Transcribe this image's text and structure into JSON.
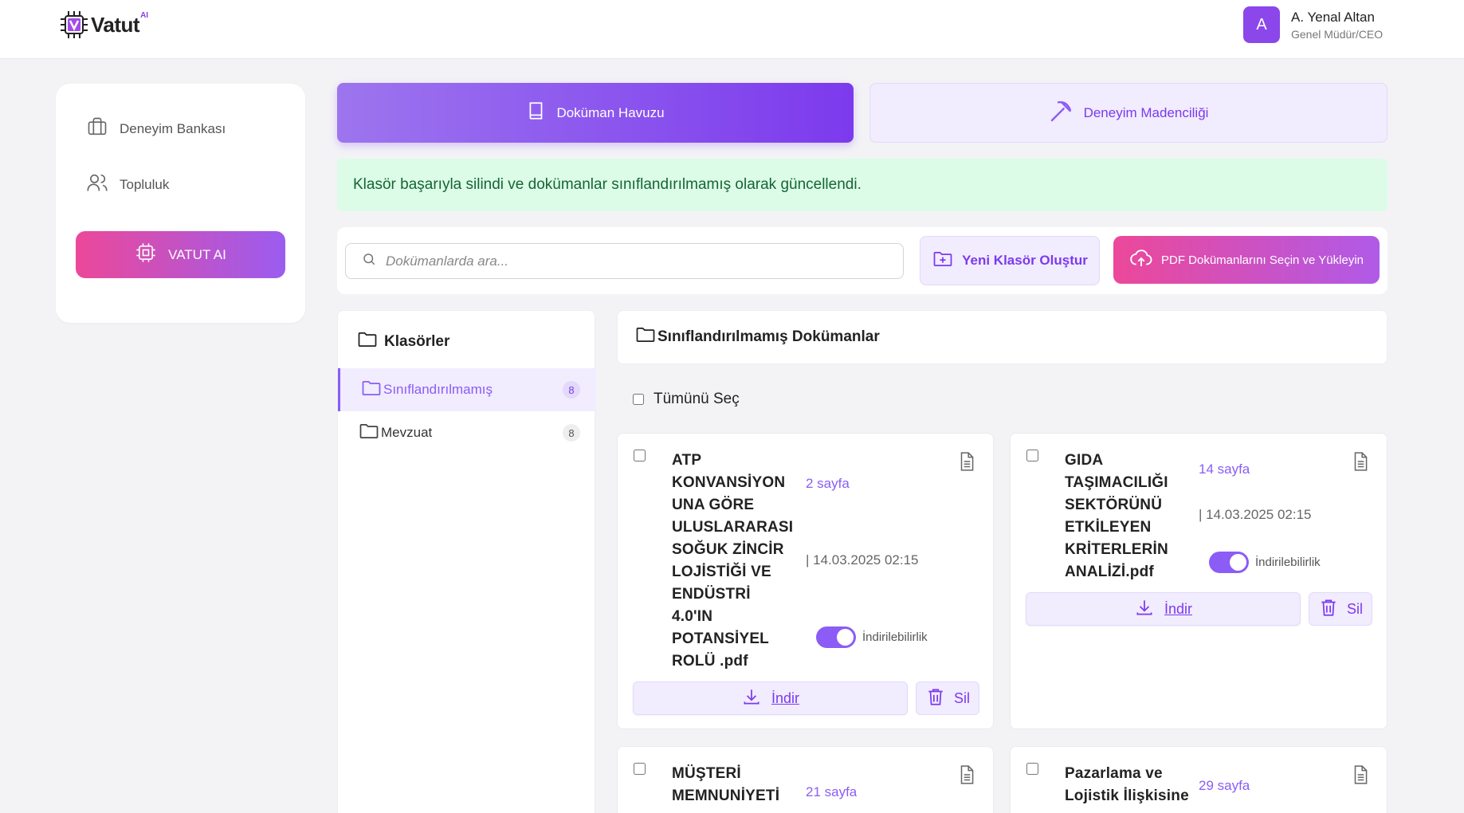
{
  "header": {
    "logo_text": "Vatut",
    "logo_superscript": "AI",
    "user": {
      "avatar_initial": "A",
      "name": "A. Yenal Altan",
      "role": "Genel Müdür/CEO"
    }
  },
  "sidebar": {
    "items": [
      {
        "label": "Deneyim Bankası",
        "icon": "briefcase-icon"
      },
      {
        "label": "Topluluk",
        "icon": "users-icon"
      }
    ],
    "ai_button_label": "VATUT AI"
  },
  "tabs": [
    {
      "label": "Doküman Havuzu",
      "active": true,
      "icon": "book-icon"
    },
    {
      "label": "Deneyim Madenciliği",
      "active": false,
      "icon": "pickaxe-icon"
    }
  ],
  "alert": {
    "message": "Klasör başarıyla silindi ve dokümanlar sınıflandırılmamış olarak güncellendi."
  },
  "toolbar": {
    "search_placeholder": "Dokümanlarda ara...",
    "new_folder_label": "Yeni Klasör Oluştur",
    "upload_label": "PDF Dokümanlarını Seçin ve Yükleyin"
  },
  "folders": {
    "title": "Klasörler",
    "items": [
      {
        "name": "Sınıflandırılmamış",
        "count": "8",
        "active": true
      },
      {
        "name": "Mevzuat",
        "count": "8",
        "active": false
      }
    ]
  },
  "content": {
    "title": "Sınıflandırılmamış Dokümanlar",
    "select_all_label": "Tümünü Seç",
    "download_label": "İndir",
    "delete_label": "Sil",
    "toggle_label": "İndirilebilirlik",
    "documents": [
      {
        "title_lines": [
          "ATP",
          "KONVANSİYON",
          "UNA GÖRE",
          "ULUSLARARASI",
          "SOĞUK ZİNCİR",
          "LOJİSTİĞİ VE",
          "ENDÜSTRİ",
          "4.0'IN",
          "POTANSİYEL",
          "ROLÜ .pdf"
        ],
        "pages": "2 sayfa",
        "date": "| 14.03.2025 02:15",
        "downloadable": true
      },
      {
        "title_lines": [
          "GIDA",
          "TAŞIMACILIĞI",
          "SEKTÖRÜNÜ",
          "ETKİLEYEN",
          "KRİTERLERİN",
          "ANALİZİ.pdf"
        ],
        "pages": "14 sayfa",
        "date": "| 14.03.2025 02:15",
        "downloadable": true
      },
      {
        "title_lines": [
          "MÜŞTERİ",
          "MEMNUNİYETİ"
        ],
        "pages": "21 sayfa"
      },
      {
        "title_lines": [
          "Pazarlama ve",
          "Lojistik İlişkisine"
        ],
        "pages": "29 sayfa"
      }
    ]
  },
  "colors": {
    "accent": "#7c3aed",
    "accent_light": "#f1ecfe",
    "success_bg": "#dcfce7",
    "success_text": "#166534",
    "pink": "#ec4899"
  }
}
